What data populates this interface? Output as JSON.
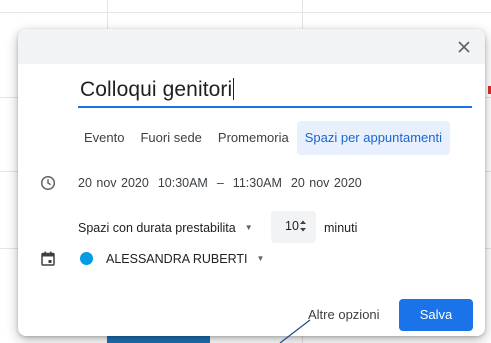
{
  "dialog": {
    "close_icon": "close-icon",
    "title_value": "Colloqui genitori",
    "tabs": [
      {
        "label": "Evento",
        "active": false
      },
      {
        "label": "Fuori sede",
        "active": false
      },
      {
        "label": "Promemoria",
        "active": false
      },
      {
        "label": "Spazi per appuntamenti",
        "active": true
      }
    ],
    "datetime": {
      "icon": "clock-icon",
      "start_date": "20 nov 2020",
      "start_time": "10:30AM",
      "separator": "–",
      "end_time": "11:30AM",
      "end_date": "20 nov 2020"
    },
    "slots": {
      "type_label": "Spazi con durata prestabilita",
      "duration_value": "10",
      "duration_unit": "minuti"
    },
    "calendar": {
      "icon": "calendar-icon",
      "owner": "ALESSANDRA RUBERTI",
      "color": "#039be5"
    },
    "actions": {
      "more_options": "Altre opzioni",
      "save": "Salva"
    }
  },
  "colors": {
    "accent": "#1a73e8",
    "tab_active_bg": "#e8f0fe",
    "titlebar_bg": "#f1f3f4"
  }
}
